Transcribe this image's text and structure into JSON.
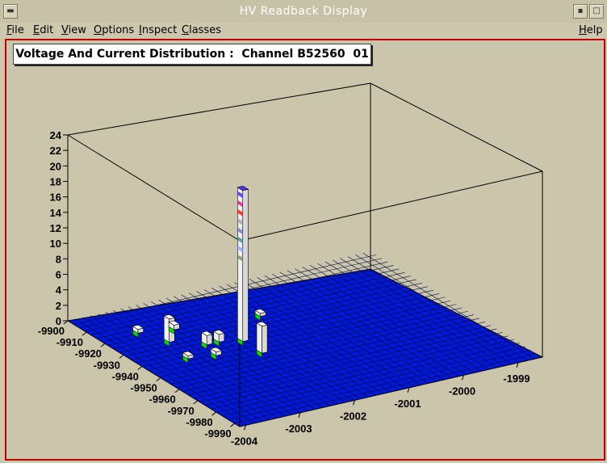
{
  "window": {
    "title": "HV Readback Display"
  },
  "menubar": {
    "items": [
      {
        "label": "File",
        "u": "F",
        "rest": "ile"
      },
      {
        "label": "Edit",
        "u": "E",
        "rest": "dit"
      },
      {
        "label": "View",
        "u": "V",
        "rest": "iew"
      },
      {
        "label": "Options",
        "u": "O",
        "rest": "ptions"
      },
      {
        "label": "Inspect",
        "u": "I",
        "rest": "nspect"
      },
      {
        "label": "Classes",
        "u": "C",
        "rest": "lasses"
      }
    ],
    "help": {
      "label": "Help",
      "u": "H",
      "rest": "elp"
    }
  },
  "plot": {
    "title": "Voltage And Current Distribution :  Channel B52560  01",
    "z_ticks": [
      "0",
      "2",
      "4",
      "6",
      "8",
      "10",
      "12",
      "14",
      "16",
      "18",
      "20",
      "22",
      "24"
    ],
    "y_ticks": [
      "-9900",
      "-9910",
      "-9920",
      "-9930",
      "-9940",
      "-9950",
      "-9960",
      "-9970",
      "-9980",
      "-9990"
    ],
    "x_ticks": [
      "-2004",
      "-2003",
      "-2002",
      "-2001",
      "-2000",
      "-1999"
    ],
    "colors": {
      "floor": "#0018d8",
      "box": "#000000",
      "bar_side": "#f0f0f0",
      "edge_marker": "#00e000"
    }
  },
  "chart_data": {
    "type": "lego",
    "title": "Voltage And Current Distribution :  Channel B52560  01",
    "zlim": [
      0,
      24
    ],
    "ylim": [
      -9990,
      -9900
    ],
    "xlim": [
      -2004,
      -1999
    ],
    "bars": [
      {
        "x": -2002.3,
        "y": -9935,
        "z": 19.5
      },
      {
        "x": -2002.3,
        "y": -9945,
        "z": 3.5
      },
      {
        "x": -2003.2,
        "y": -9925,
        "z": 3.0
      },
      {
        "x": -2002.8,
        "y": -9932,
        "z": 1.2
      },
      {
        "x": -2002.6,
        "y": -9932,
        "z": 1.0
      },
      {
        "x": -2002.9,
        "y": -9918,
        "z": 0.6
      },
      {
        "x": -2003.4,
        "y": -9915,
        "z": 0.5
      },
      {
        "x": -2001.6,
        "y": -9922,
        "z": 0.4
      },
      {
        "x": -2002.9,
        "y": -9940,
        "z": 0.5
      },
      {
        "x": -2003.3,
        "y": -9938,
        "z": 0.4
      }
    ]
  }
}
